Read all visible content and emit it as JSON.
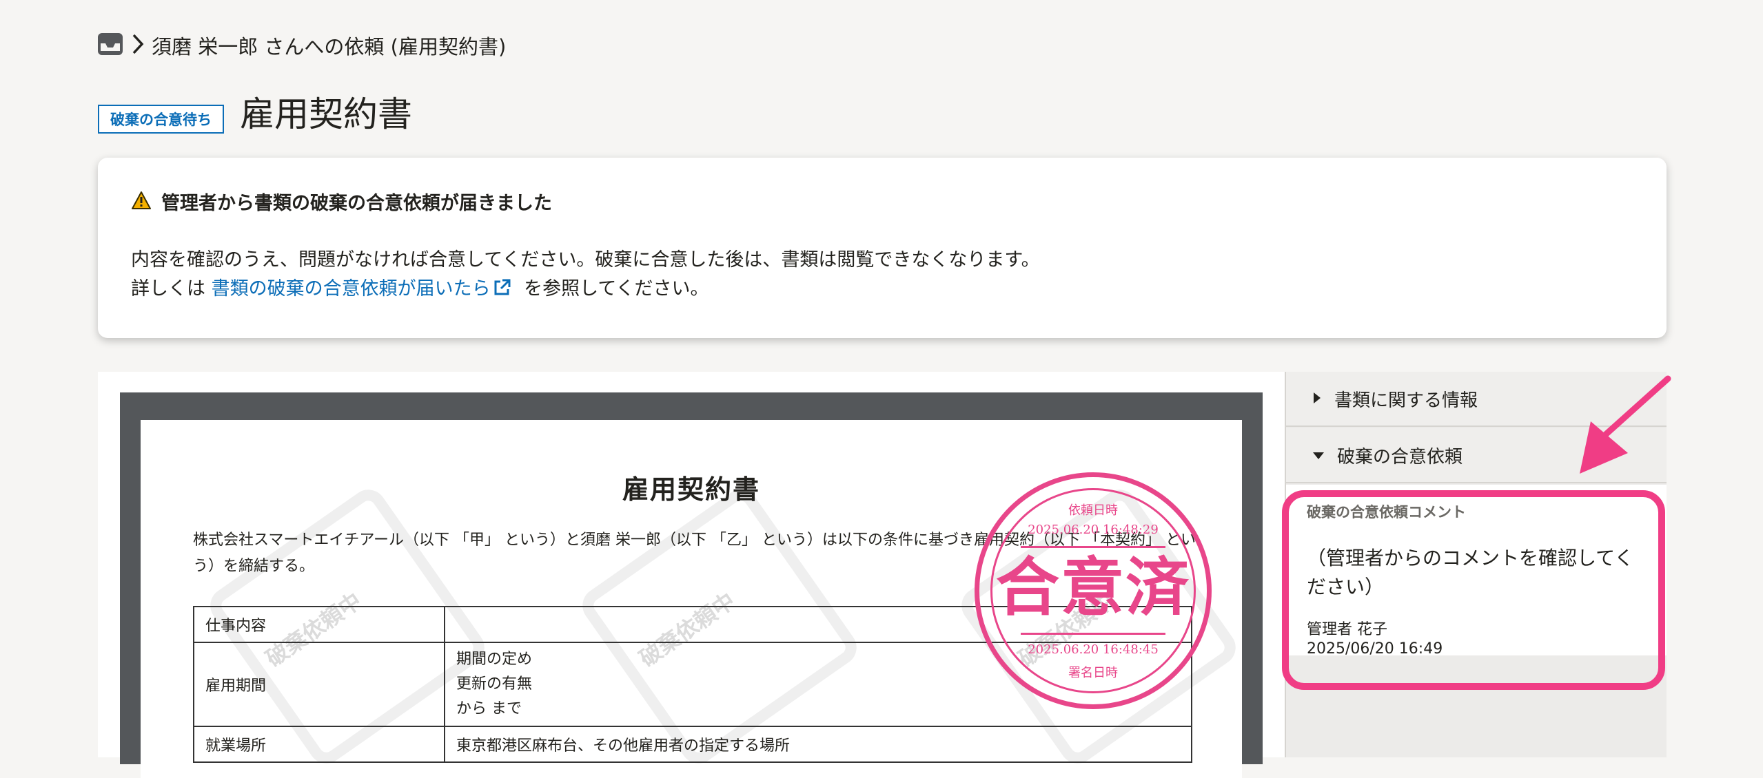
{
  "breadcrumb": {
    "icon": "inbox-icon",
    "separator_icon": "chevron-right-icon",
    "text": "須磨 栄一郎 さんへの依頼 (雇用契約書)"
  },
  "header": {
    "status_badge": "破棄の合意待ち",
    "title": "雇用契約書"
  },
  "alert": {
    "icon": "warning-icon",
    "title": "管理者から書類の破棄の合意依頼が届きました",
    "line1": "内容を確認のうえ、問題がなければ合意してください。破棄に合意した後は、書類は閲覧できなくなります。",
    "line2_prefix": "詳しくは ",
    "link_text": "書類の破棄の合意依頼が届いたら",
    "link_icon": "external-link-icon",
    "line2_suffix": " を参照してください。"
  },
  "document": {
    "title": "雇用契約書",
    "intro": "株式会社スマートエイチアール（以下 「甲」 という）と須磨 栄一郎（以下 「乙」 という）は以下の条件に基づき雇用契約（以下 「本契約」 という）を締結する。",
    "rows": [
      {
        "label": "仕事内容",
        "value_lines": [
          ""
        ]
      },
      {
        "label": "雇用期間",
        "value_lines": [
          "期間の定め",
          "更新の有無",
          "から まで"
        ]
      },
      {
        "label": "就業場所",
        "value_lines": [
          "東京都港区麻布台、その他雇用者の指定する場所"
        ]
      }
    ],
    "watermark_text": "破棄依頼中",
    "stamp": {
      "top_label": "依頼日時",
      "top_time": "2025.06.20 16:48:29",
      "main": "合意済",
      "bottom_time": "2025.06.20 16:48:45",
      "bottom_label": "署名日時"
    }
  },
  "side": {
    "sections": [
      {
        "label": "書類に関する情報",
        "icon": "caret-right-icon"
      },
      {
        "label": "破棄の合意依頼",
        "icon": "caret-down-icon"
      }
    ],
    "comment": {
      "label": "破棄の合意依頼コメント",
      "text": "（管理者からのコメントを確認してください）",
      "author": "管理者 花子",
      "time": "2025/06/20 16:49"
    }
  },
  "colors": {
    "accent": "#0b6db7",
    "annotation": "#f03d85",
    "stamp": "#e8468a"
  }
}
